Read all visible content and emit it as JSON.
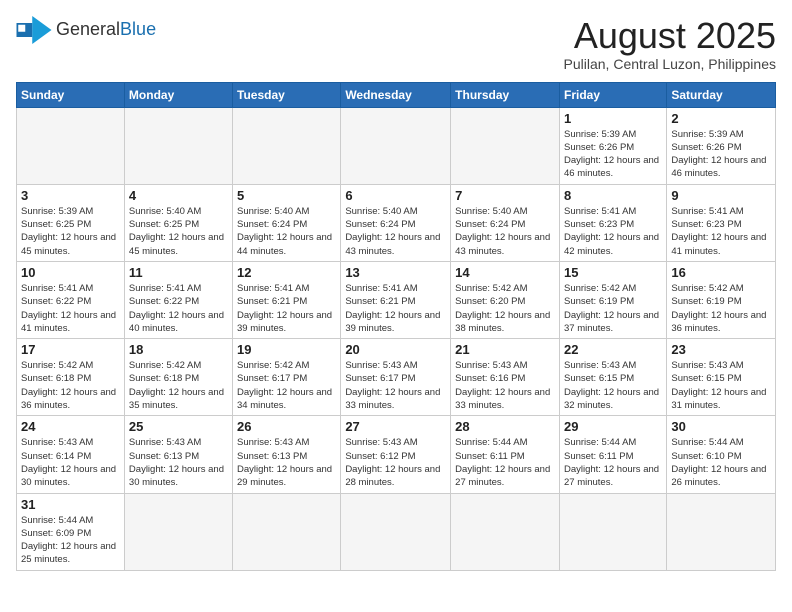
{
  "logo": {
    "line1": "General",
    "line2": "Blue"
  },
  "title": "August 2025",
  "location": "Pulilan, Central Luzon, Philippines",
  "weekdays": [
    "Sunday",
    "Monday",
    "Tuesday",
    "Wednesday",
    "Thursday",
    "Friday",
    "Saturday"
  ],
  "weeks": [
    [
      {
        "day": "",
        "info": ""
      },
      {
        "day": "",
        "info": ""
      },
      {
        "day": "",
        "info": ""
      },
      {
        "day": "",
        "info": ""
      },
      {
        "day": "",
        "info": ""
      },
      {
        "day": "1",
        "info": "Sunrise: 5:39 AM\nSunset: 6:26 PM\nDaylight: 12 hours and 46 minutes."
      },
      {
        "day": "2",
        "info": "Sunrise: 5:39 AM\nSunset: 6:26 PM\nDaylight: 12 hours and 46 minutes."
      }
    ],
    [
      {
        "day": "3",
        "info": "Sunrise: 5:39 AM\nSunset: 6:25 PM\nDaylight: 12 hours and 45 minutes."
      },
      {
        "day": "4",
        "info": "Sunrise: 5:40 AM\nSunset: 6:25 PM\nDaylight: 12 hours and 45 minutes."
      },
      {
        "day": "5",
        "info": "Sunrise: 5:40 AM\nSunset: 6:24 PM\nDaylight: 12 hours and 44 minutes."
      },
      {
        "day": "6",
        "info": "Sunrise: 5:40 AM\nSunset: 6:24 PM\nDaylight: 12 hours and 43 minutes."
      },
      {
        "day": "7",
        "info": "Sunrise: 5:40 AM\nSunset: 6:24 PM\nDaylight: 12 hours and 43 minutes."
      },
      {
        "day": "8",
        "info": "Sunrise: 5:41 AM\nSunset: 6:23 PM\nDaylight: 12 hours and 42 minutes."
      },
      {
        "day": "9",
        "info": "Sunrise: 5:41 AM\nSunset: 6:23 PM\nDaylight: 12 hours and 41 minutes."
      }
    ],
    [
      {
        "day": "10",
        "info": "Sunrise: 5:41 AM\nSunset: 6:22 PM\nDaylight: 12 hours and 41 minutes."
      },
      {
        "day": "11",
        "info": "Sunrise: 5:41 AM\nSunset: 6:22 PM\nDaylight: 12 hours and 40 minutes."
      },
      {
        "day": "12",
        "info": "Sunrise: 5:41 AM\nSunset: 6:21 PM\nDaylight: 12 hours and 39 minutes."
      },
      {
        "day": "13",
        "info": "Sunrise: 5:41 AM\nSunset: 6:21 PM\nDaylight: 12 hours and 39 minutes."
      },
      {
        "day": "14",
        "info": "Sunrise: 5:42 AM\nSunset: 6:20 PM\nDaylight: 12 hours and 38 minutes."
      },
      {
        "day": "15",
        "info": "Sunrise: 5:42 AM\nSunset: 6:19 PM\nDaylight: 12 hours and 37 minutes."
      },
      {
        "day": "16",
        "info": "Sunrise: 5:42 AM\nSunset: 6:19 PM\nDaylight: 12 hours and 36 minutes."
      }
    ],
    [
      {
        "day": "17",
        "info": "Sunrise: 5:42 AM\nSunset: 6:18 PM\nDaylight: 12 hours and 36 minutes."
      },
      {
        "day": "18",
        "info": "Sunrise: 5:42 AM\nSunset: 6:18 PM\nDaylight: 12 hours and 35 minutes."
      },
      {
        "day": "19",
        "info": "Sunrise: 5:42 AM\nSunset: 6:17 PM\nDaylight: 12 hours and 34 minutes."
      },
      {
        "day": "20",
        "info": "Sunrise: 5:43 AM\nSunset: 6:17 PM\nDaylight: 12 hours and 33 minutes."
      },
      {
        "day": "21",
        "info": "Sunrise: 5:43 AM\nSunset: 6:16 PM\nDaylight: 12 hours and 33 minutes."
      },
      {
        "day": "22",
        "info": "Sunrise: 5:43 AM\nSunset: 6:15 PM\nDaylight: 12 hours and 32 minutes."
      },
      {
        "day": "23",
        "info": "Sunrise: 5:43 AM\nSunset: 6:15 PM\nDaylight: 12 hours and 31 minutes."
      }
    ],
    [
      {
        "day": "24",
        "info": "Sunrise: 5:43 AM\nSunset: 6:14 PM\nDaylight: 12 hours and 30 minutes."
      },
      {
        "day": "25",
        "info": "Sunrise: 5:43 AM\nSunset: 6:13 PM\nDaylight: 12 hours and 30 minutes."
      },
      {
        "day": "26",
        "info": "Sunrise: 5:43 AM\nSunset: 6:13 PM\nDaylight: 12 hours and 29 minutes."
      },
      {
        "day": "27",
        "info": "Sunrise: 5:43 AM\nSunset: 6:12 PM\nDaylight: 12 hours and 28 minutes."
      },
      {
        "day": "28",
        "info": "Sunrise: 5:44 AM\nSunset: 6:11 PM\nDaylight: 12 hours and 27 minutes."
      },
      {
        "day": "29",
        "info": "Sunrise: 5:44 AM\nSunset: 6:11 PM\nDaylight: 12 hours and 27 minutes."
      },
      {
        "day": "30",
        "info": "Sunrise: 5:44 AM\nSunset: 6:10 PM\nDaylight: 12 hours and 26 minutes."
      }
    ],
    [
      {
        "day": "31",
        "info": "Sunrise: 5:44 AM\nSunset: 6:09 PM\nDaylight: 12 hours and 25 minutes."
      },
      {
        "day": "",
        "info": ""
      },
      {
        "day": "",
        "info": ""
      },
      {
        "day": "",
        "info": ""
      },
      {
        "day": "",
        "info": ""
      },
      {
        "day": "",
        "info": ""
      },
      {
        "day": "",
        "info": ""
      }
    ]
  ]
}
